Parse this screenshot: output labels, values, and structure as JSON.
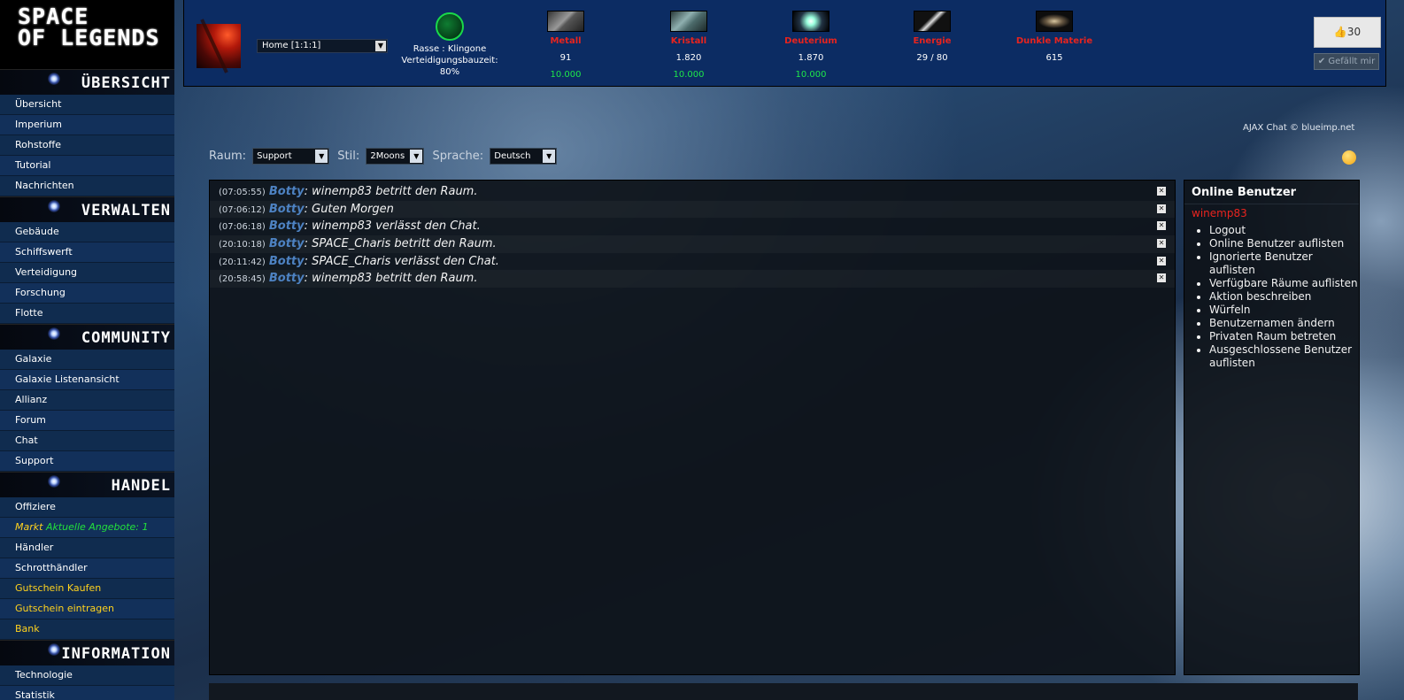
{
  "logo": {
    "line1": "SPACE",
    "line2": "OF LEGENDS"
  },
  "sidebar": {
    "sections": [
      {
        "title": "ÜBERSICHT",
        "items": [
          "Übersicht",
          "Imperium",
          "Rohstoffe",
          "Tutorial",
          "Nachrichten"
        ]
      },
      {
        "title": "VERWALTEN",
        "items": [
          "Gebäude",
          "Schiffswerft",
          "Verteidigung",
          "Forschung",
          "Flotte"
        ]
      },
      {
        "title": "COMMUNITY",
        "items": [
          "Galaxie",
          "Galaxie Listenansicht",
          "Allianz",
          "Forum",
          "Chat",
          "Support"
        ]
      },
      {
        "title": "HANDEL",
        "items": [
          "Offiziere",
          "Händler",
          "Schrotthändler",
          "Gutschein Kaufen",
          "Gutschein eintragen",
          "Bank"
        ]
      },
      {
        "title": "INFORMATION",
        "items": [
          "Technologie",
          "Statistik"
        ]
      }
    ],
    "markt": {
      "label": "Markt",
      "offers": "Aktuelle Angebote: 1"
    }
  },
  "topbar": {
    "planet_select": "Home [1:1:1]",
    "race": "Rasse : Klingone",
    "defense_label": "Verteidigungsbauzeit:",
    "defense_value": "80%",
    "resources": [
      {
        "name": "Metall",
        "value": "91",
        "capacity": "10.000"
      },
      {
        "name": "Kristall",
        "value": "1.820",
        "capacity": "10.000"
      },
      {
        "name": "Deuterium",
        "value": "1.870",
        "capacity": "10.000"
      },
      {
        "name": "Energie",
        "value": "29 / 80",
        "capacity": ""
      },
      {
        "name": "Dunkle Materie",
        "value": "615",
        "capacity": ""
      }
    ],
    "likes": "30",
    "like_button": "Gefällt mir"
  },
  "chat": {
    "credit": "AJAX Chat © blueimp.net",
    "room_label": "Raum:",
    "room_value": "Support",
    "style_label": "Stil:",
    "style_value": "2Moons",
    "lang_label": "Sprache:",
    "lang_value": "Deutsch",
    "messages": [
      {
        "time": "(07:05:55)",
        "user": "Botty",
        "text": ": winemp83 betritt den Raum."
      },
      {
        "time": "(07:06:12)",
        "user": "Botty",
        "text": ": Guten Morgen"
      },
      {
        "time": "(07:06:18)",
        "user": "Botty",
        "text": ": winemp83 verlässt den Chat."
      },
      {
        "time": "(20:10:18)",
        "user": "Botty",
        "text": ": SPACE_Charis betritt den Raum."
      },
      {
        "time": "(20:11:42)",
        "user": "Botty",
        "text": ": SPACE_Charis verlässt den Chat."
      },
      {
        "time": "(20:58:45)",
        "user": "Botty",
        "text": ": winemp83 betritt den Raum."
      }
    ],
    "online_title": "Online Benutzer",
    "current_user": "winemp83",
    "user_menu": [
      "Logout",
      "Online Benutzer auflisten",
      "Ignorierte Benutzer auflisten",
      "Verfügbare Räume auflisten",
      "Aktion beschreiben",
      "Würfeln",
      "Benutzernamen ändern",
      "Privaten Raum betreten",
      "Ausgeschlossene Benutzer auflisten"
    ]
  }
}
